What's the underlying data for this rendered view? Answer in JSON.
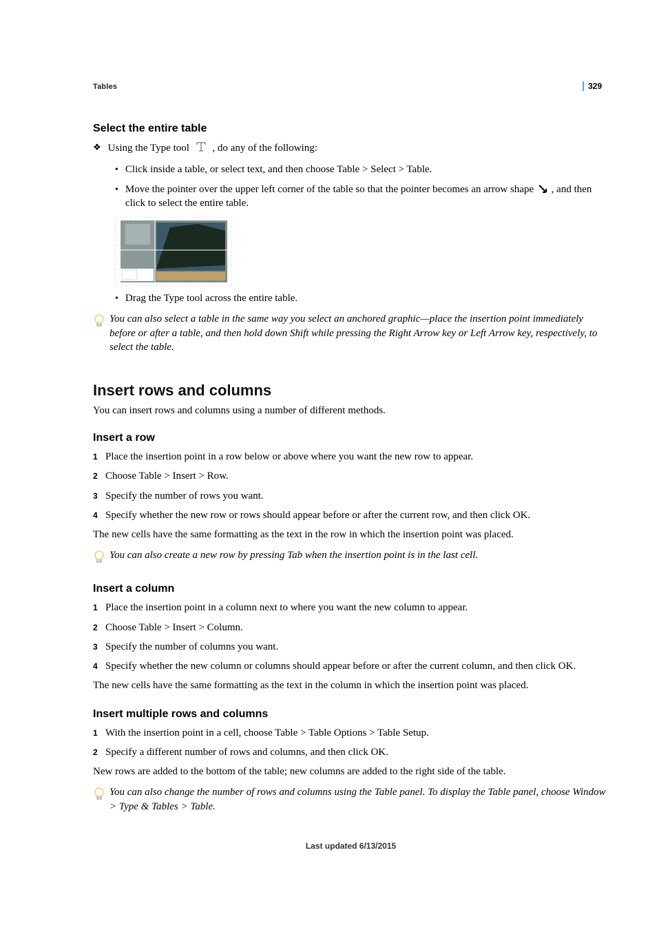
{
  "page_number": "329",
  "top_label": "Tables",
  "s1": {
    "heading": "Select the entire table",
    "lead_prefix": "Using the Type tool",
    "lead_suffix": ", do any of the following:",
    "b1": "Click inside a table, or select text, and then choose Table > Select > Table.",
    "b2_a": "Move the pointer over the upper left corner of the table so that the pointer becomes an arrow shape",
    "b2_b": ", and then click to select the entire table.",
    "b3": "Drag the Type tool across the entire table.",
    "tip": "You can also select a table in the same way you select an anchored graphic—place the insertion point immediately before or after a table, and then hold down Shift while pressing the Right Arrow key or Left Arrow key, respectively, to select the table."
  },
  "s2": {
    "heading": "Insert rows and columns",
    "lead": "You can insert rows and columns using a number of different methods."
  },
  "s3": {
    "heading": "Insert a row",
    "n1": "Place the insertion point in a row below or above where you want the new row to appear.",
    "n2": "Choose Table > Insert > Row.",
    "n3": "Specify the number of rows you want.",
    "n4": "Specify whether the new row or rows should appear before or after the current row, and then click OK.",
    "post": "The new cells have the same formatting as the text in the row in which the insertion point was placed.",
    "tip": "You can also create a new row by pressing Tab when the insertion point is in the last cell."
  },
  "s4": {
    "heading": "Insert a column",
    "n1": "Place the insertion point in a column next to where you want the new column to appear.",
    "n2": "Choose Table > Insert > Column.",
    "n3": "Specify the number of columns you want.",
    "n4": "Specify whether the new column or columns should appear before or after the current column, and then click OK.",
    "post": "The new cells have the same formatting as the text in the column in which the insertion point was placed."
  },
  "s5": {
    "heading": "Insert multiple rows and columns",
    "n1": "With the insertion point in a cell, choose Table > Table Options > Table Setup.",
    "n2": "Specify a different number of rows and columns, and then click OK.",
    "post": "New rows are added to the bottom of the table; new columns are added to the right side of the table.",
    "tip": "You can also change the number of rows and columns using the Table panel. To display the Table panel, choose Window > Type & Tables > Table."
  },
  "footer": "Last updated 6/13/2015",
  "numbers": {
    "n1": "1",
    "n2": "2",
    "n3": "3",
    "n4": "4"
  }
}
